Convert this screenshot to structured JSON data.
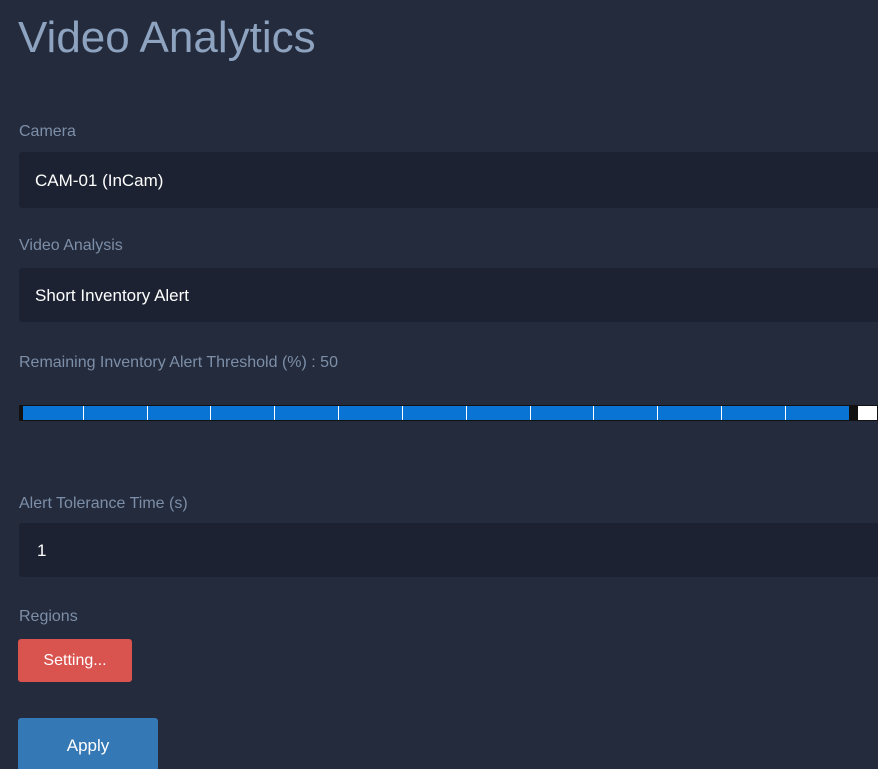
{
  "page": {
    "title": "Video Analytics"
  },
  "camera": {
    "label": "Camera",
    "value": "CAM-01 (InCam)"
  },
  "video_analysis": {
    "label": "Video Analysis",
    "value": "Short Inventory Alert"
  },
  "threshold": {
    "label": "Remaining Inventory Alert Threshold (%) : 50",
    "fill_fraction": 0.967
  },
  "tolerance": {
    "label": "Alert Tolerance Time (s)",
    "value": "1"
  },
  "regions": {
    "label": "Regions",
    "button_label": "Setting..."
  },
  "actions": {
    "apply_label": "Apply"
  },
  "colors": {
    "background": "#242b3d",
    "field_background": "#1c2231",
    "slider_fill": "#0a74d4",
    "setting_button": "#d9534f",
    "apply_button": "#3478b5"
  }
}
